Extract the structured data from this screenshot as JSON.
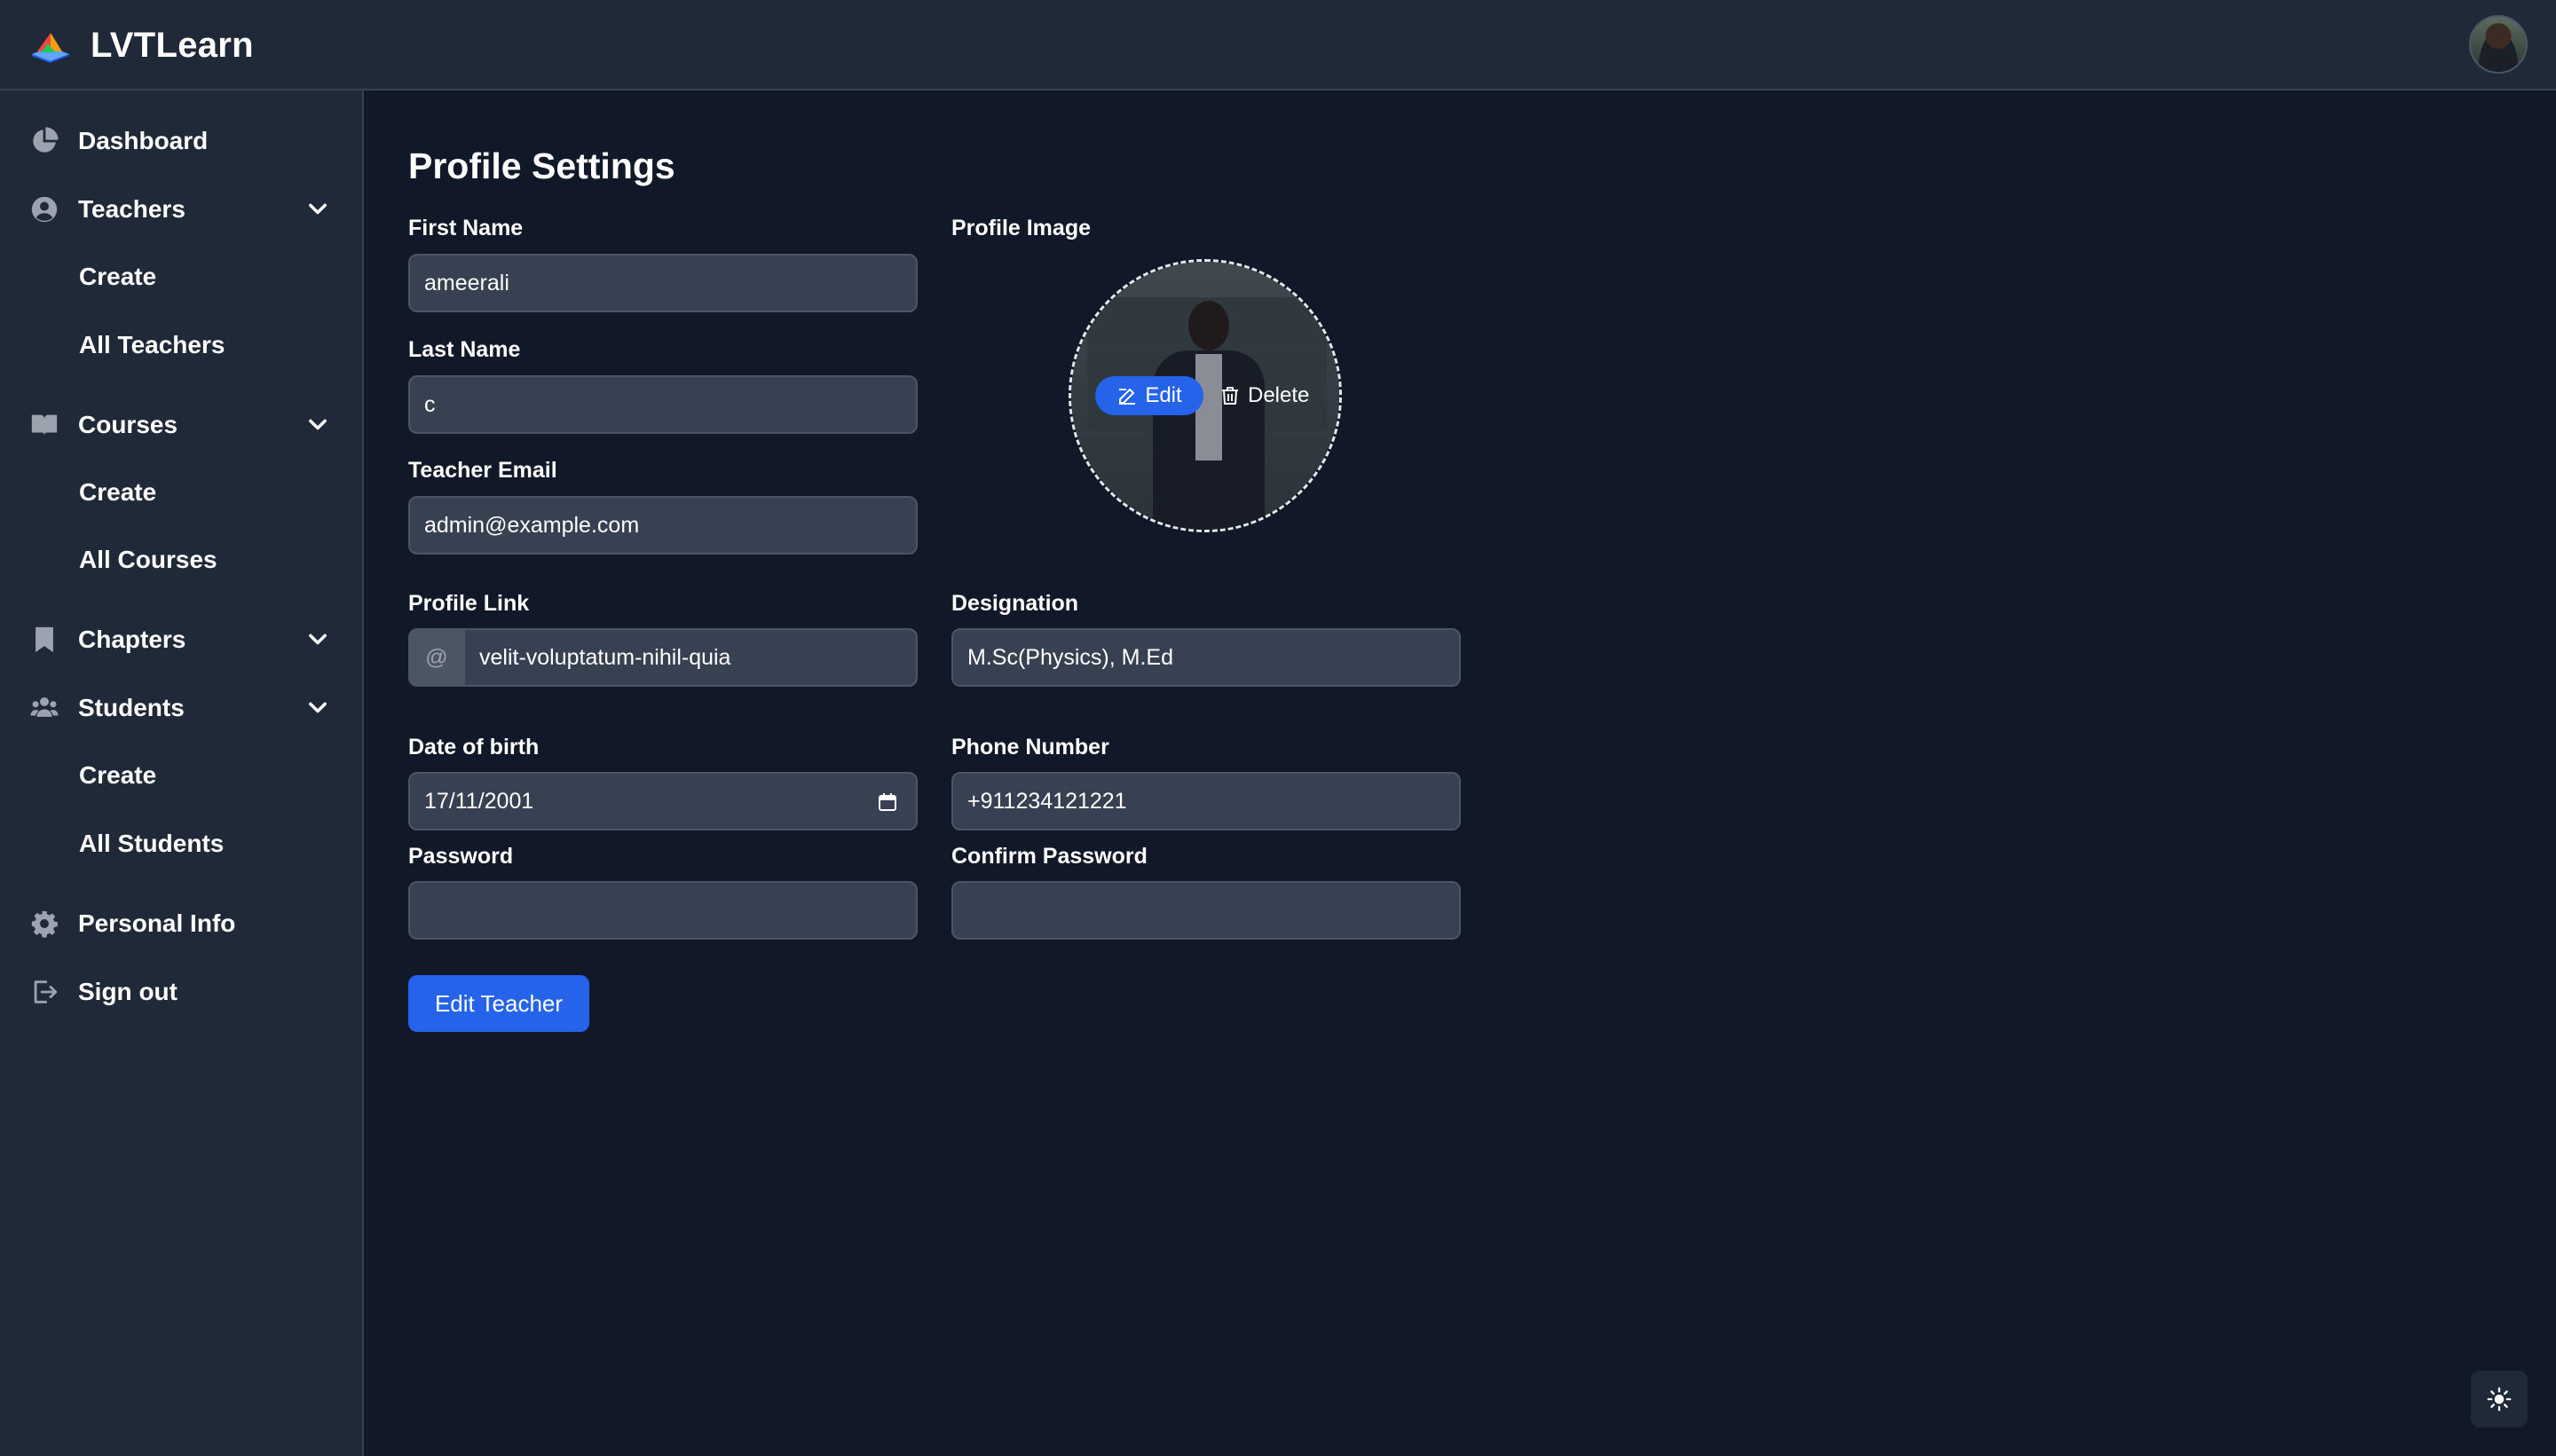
{
  "app": {
    "name": "LVTLearn"
  },
  "sidebar": {
    "dashboard": "Dashboard",
    "teachers": {
      "label": "Teachers",
      "create": "Create",
      "all": "All Teachers"
    },
    "courses": {
      "label": "Courses",
      "create": "Create",
      "all": "All Courses"
    },
    "chapters": {
      "label": "Chapters"
    },
    "students": {
      "label": "Students",
      "create": "Create",
      "all": "All Students"
    },
    "personal_info": "Personal Info",
    "sign_out": "Sign out"
  },
  "form": {
    "title": "Profile Settings",
    "first_name": {
      "label": "First Name",
      "value": "ameerali"
    },
    "last_name": {
      "label": "Last Name",
      "value": "c"
    },
    "email": {
      "label": "Teacher Email",
      "value": "admin@example.com"
    },
    "profile_link": {
      "label": "Profile Link",
      "prefix": "@",
      "value": "velit-voluptatum-nihil-quia"
    },
    "designation": {
      "label": "Designation",
      "value": "M.Sc(Physics), M.Ed"
    },
    "dob": {
      "label": "Date of birth",
      "value": "17/11/2001"
    },
    "phone": {
      "label": "Phone Number",
      "value": "+911234121221"
    },
    "password": {
      "label": "Password",
      "value": ""
    },
    "confirm_password": {
      "label": "Confirm Password",
      "value": ""
    },
    "profile_image": {
      "label": "Profile Image",
      "edit": "Edit",
      "delete": "Delete"
    },
    "submit": "Edit Teacher"
  },
  "colors": {
    "accent": "#2563eb",
    "background": "#111827",
    "panel": "#1f2937",
    "input": "#374151"
  }
}
